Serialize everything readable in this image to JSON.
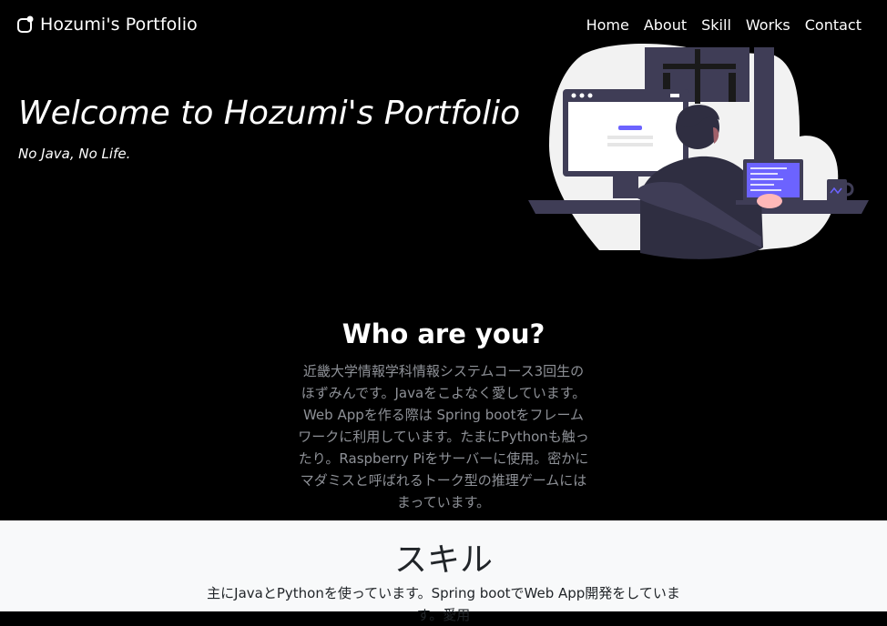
{
  "navbar": {
    "brand": "Hozumi's Portfolio",
    "links": [
      "Home",
      "About",
      "Skill",
      "Works",
      "Contact"
    ]
  },
  "hero": {
    "title": "Welcome to Hozumi's Portfolio",
    "tagline": "No Java, No Life."
  },
  "about": {
    "title": "Who are you?",
    "body": "近畿大学情報学科情報システムコース3回生のほずみんです。Javaをこよなく愛しています。Web Appを作る際は Spring bootをフレームワークに利用しています。たまにPythonも触ったり。Raspberry Piをサーバーに使用。密かに マダミスと呼ばれるトーク型の推理ゲームにはまっています。"
  },
  "skill": {
    "title": "スキル",
    "body": "主にJavaとPythonを使っています。Spring bootでWeb App開発をしています。愛用"
  },
  "colors": {
    "accent": "#6c63ff",
    "figure": "#3f3d56",
    "muted_text": "#8e9197",
    "light_section": "#f8f9fa"
  },
  "icons": {
    "brand": "bootstrap-logo-icon"
  }
}
